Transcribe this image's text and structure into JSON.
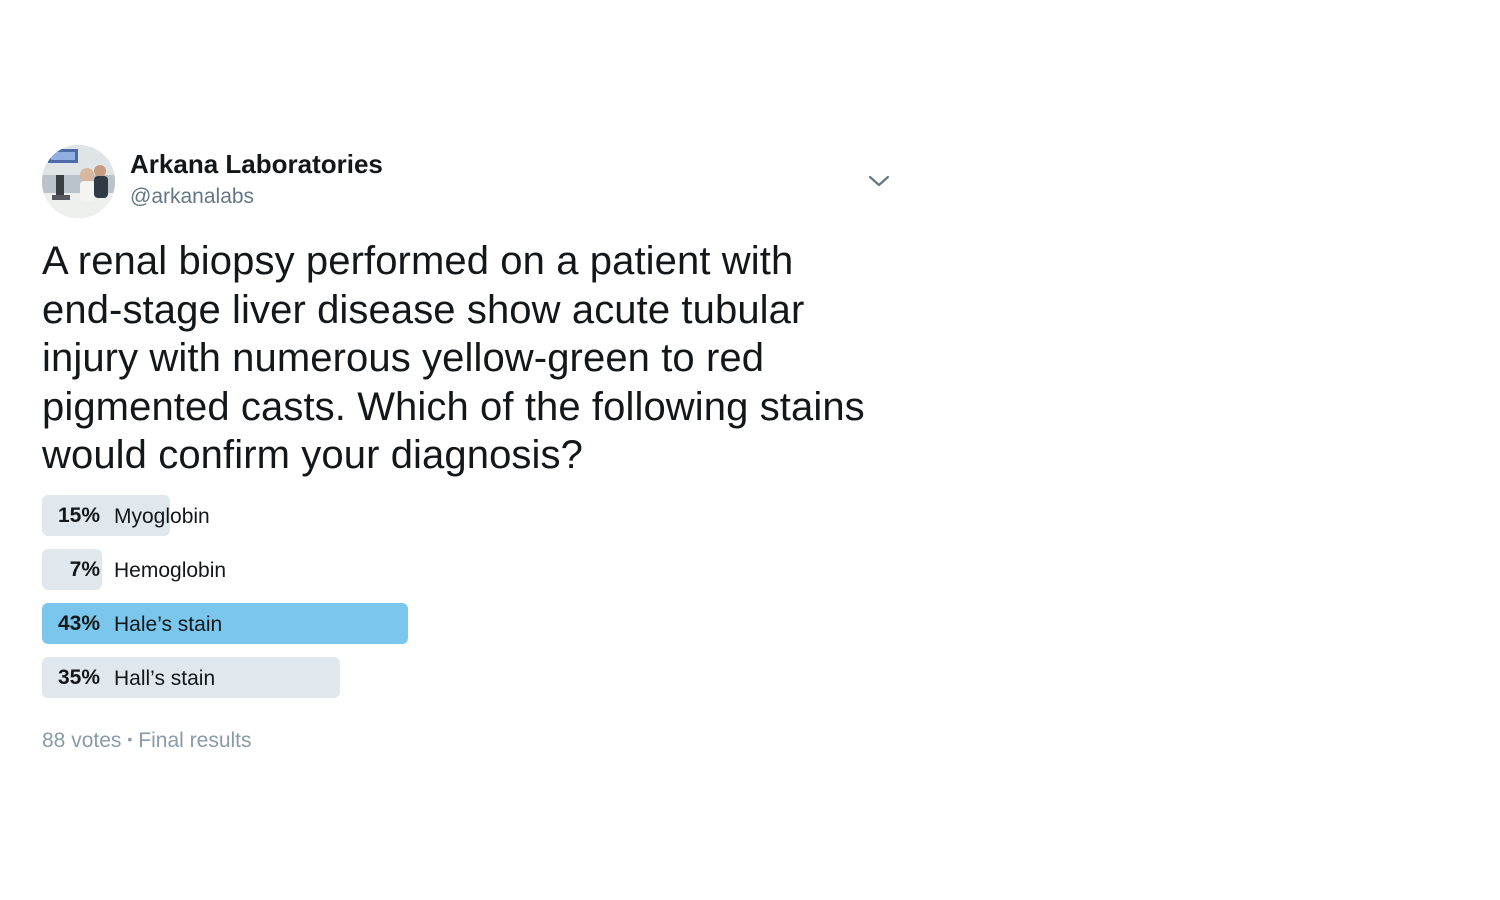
{
  "author": {
    "display_name": "Arkana Laboratories",
    "handle": "@arkanalabs",
    "avatar_icon": "lab-photo-avatar"
  },
  "menu_icon": "chevron-down-icon",
  "tweet": {
    "text": "A renal biopsy performed on a patient with end-stage liver disease show acute tubular injury with numerous yellow-green to red pigmented casts. Which of the following stains would confirm your diagnosis?"
  },
  "poll": {
    "options": [
      {
        "percent_label": "15%",
        "label": "Myoglobin",
        "fraction": 0.15,
        "winner": false
      },
      {
        "percent_label": "7%",
        "label": "Hemoglobin",
        "fraction": 0.07,
        "winner": false
      },
      {
        "percent_label": "43%",
        "label": "Hale’s stain",
        "fraction": 0.43,
        "winner": true
      },
      {
        "percent_label": "35%",
        "label": "Hall’s stain",
        "fraction": 0.35,
        "winner": false
      }
    ],
    "votes": "88 votes",
    "separator": "•",
    "status": "Final results"
  },
  "colors": {
    "winner_bar": "#7ac6ec",
    "bar": "#e1e8ed",
    "secondary_text": "#657786"
  }
}
